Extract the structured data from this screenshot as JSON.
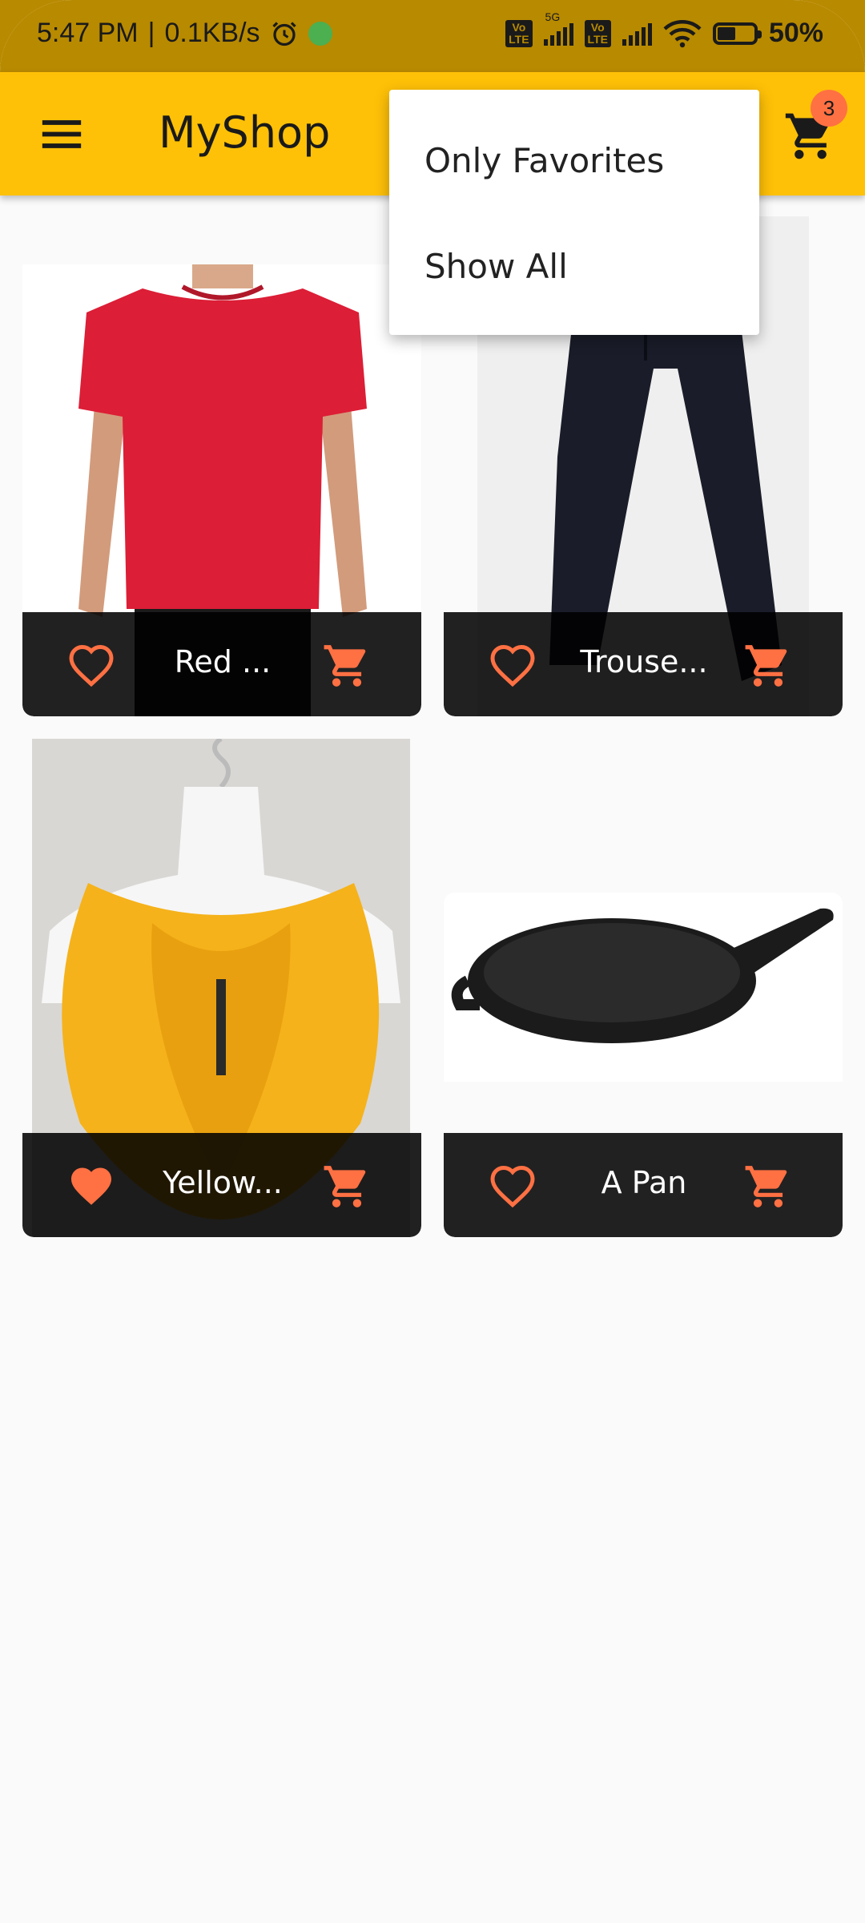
{
  "status_bar": {
    "time": "5:47 PM",
    "separator": "|",
    "network_speed": "0.1KB/s",
    "lte_1": "Vo\nLTE",
    "fiveg": "5G",
    "lte_2": "Vo\nLTE",
    "battery_percent": "50%",
    "battery_level": 0.5
  },
  "app_bar": {
    "title": "MyShop",
    "cart_count": "3"
  },
  "dropdown": {
    "items": [
      {
        "label": "Only Favorites"
      },
      {
        "label": "Show All"
      }
    ]
  },
  "products": [
    {
      "title": "Red ...",
      "favorite": false,
      "image": "red-tshirt"
    },
    {
      "title": "Trouse...",
      "favorite": false,
      "image": "trousers"
    },
    {
      "title": "Yellow...",
      "favorite": true,
      "image": "yellow-scarf"
    },
    {
      "title": "A Pan",
      "favorite": false,
      "image": "pan"
    }
  ],
  "colors": {
    "accent": "#ffc107",
    "status_bar": "#b88a00",
    "icon_orange": "#ff7043",
    "footer": "#1f1f1f"
  },
  "icons": {
    "menu": "menu-icon",
    "cart": "cart-icon",
    "favorite_outline": "heart-outline-icon",
    "favorite_filled": "heart-filled-icon",
    "add_to_cart": "add-cart-icon"
  }
}
